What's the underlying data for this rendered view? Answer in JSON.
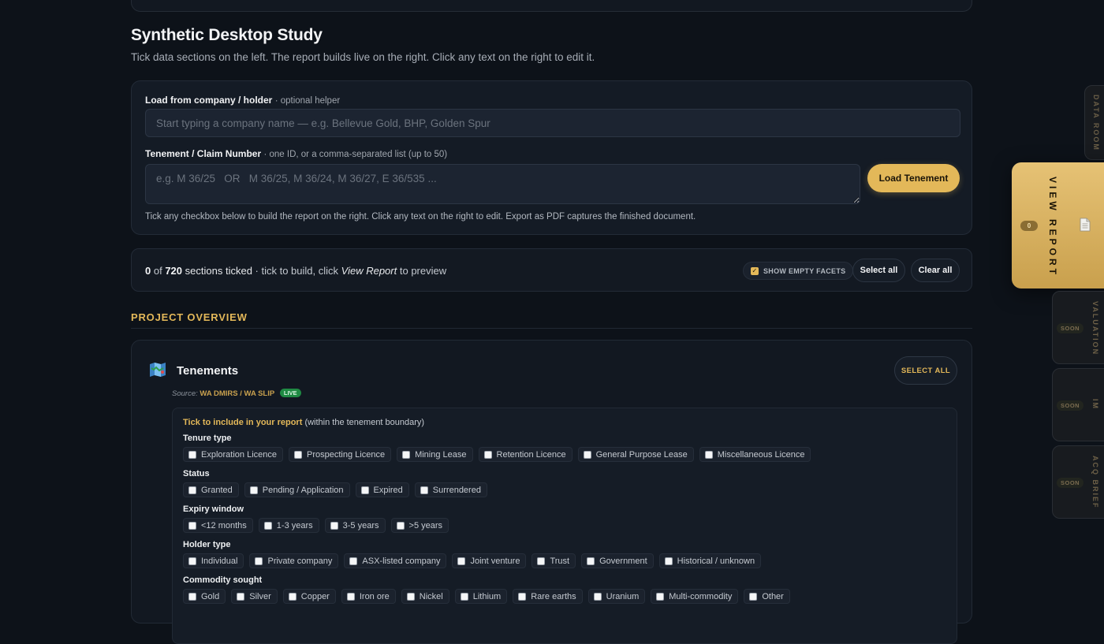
{
  "page": {
    "title": "Synthetic Desktop Study",
    "subtitle": "Tick data sections on the left. The report builds live on the right. Click any text on the right to edit it."
  },
  "loader": {
    "company_label": "Load from company / holder",
    "company_hint": "· optional helper",
    "company_placeholder": "Start typing a company name — e.g. Bellevue Gold, BHP, Golden Spur",
    "tenement_label": "Tenement / Claim Number",
    "tenement_hint": "· one ID, or a comma-separated list (up to 50)",
    "tenement_placeholder": "e.g. M 36/25   OR   M 36/25, M 36/24, M 36/27, E 36/535 ...",
    "load_button": "Load Tenement",
    "note": "Tick any checkbox below to build the report on the right. Click any text on the right to edit. Export as PDF captures the finished document."
  },
  "status": {
    "ticked": "0",
    "of": "of",
    "total": "720",
    "ticked_label": "sections ticked",
    "hint_pre": "· tick to build, click",
    "hint_em": "View Report",
    "hint_post": "to preview",
    "show_empty_label": "SHOW EMPTY FACETS",
    "show_empty_checked": true,
    "select_all": "Select all",
    "clear_all": "Clear all"
  },
  "section": {
    "heading": "PROJECT OVERVIEW"
  },
  "tenements": {
    "title": "Tenements",
    "source_label": "Source:",
    "source_value": "WA DMIRS / WA SLIP",
    "live_badge": "LIVE",
    "select_all": "SELECT ALL",
    "intro_bold": "Tick to include in your report",
    "intro_rest": "(within the tenement boundary)",
    "groups": [
      {
        "label": "Tenure type",
        "options": [
          "Exploration Licence",
          "Prospecting Licence",
          "Mining Lease",
          "Retention Licence",
          "General Purpose Lease",
          "Miscellaneous Licence"
        ]
      },
      {
        "label": "Status",
        "options": [
          "Granted",
          "Pending / Application",
          "Expired",
          "Surrendered"
        ]
      },
      {
        "label": "Expiry window",
        "options": [
          "<12 months",
          "1-3 years",
          "3-5 years",
          ">5 years"
        ]
      },
      {
        "label": "Holder type",
        "options": [
          "Individual",
          "Private company",
          "ASX-listed company",
          "Joint venture",
          "Trust",
          "Government",
          "Historical / unknown"
        ]
      },
      {
        "label": "Commodity sought",
        "options": [
          "Gold",
          "Silver",
          "Copper",
          "Iron ore",
          "Nickel",
          "Lithium",
          "Rare earths",
          "Uranium",
          "Multi-commodity",
          "Other"
        ]
      }
    ]
  },
  "rail": {
    "data_room": "DATA ROOM",
    "view_report": "VIEW REPORT",
    "report_count": "0",
    "valuation": "VALUATION",
    "im": "IM",
    "acq_brief": "ACQ BRIEF",
    "soon": "SOON"
  },
  "colors": {
    "background": "#0d1219",
    "accent": "#e3b859",
    "live_badge": "#1f8a43"
  }
}
